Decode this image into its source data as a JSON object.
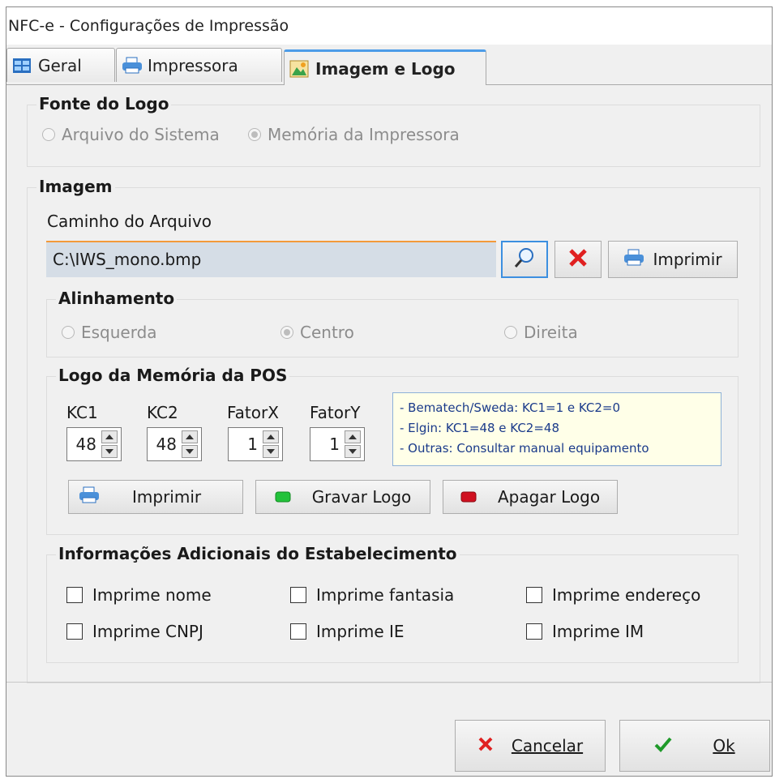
{
  "window": {
    "title": "NFC-e - Configurações de Impressão"
  },
  "tabs": [
    {
      "label": "Geral",
      "icon": "grid-icon"
    },
    {
      "label": "Impressora",
      "icon": "printer-icon"
    },
    {
      "label": "Imagem e Logo",
      "icon": "image-logo-icon",
      "active": true
    }
  ],
  "fonte_logo": {
    "title": "Fonte do Logo",
    "options": [
      {
        "label": "Arquivo do Sistema",
        "selected": false
      },
      {
        "label": "Memória da Impressora",
        "selected": true
      }
    ]
  },
  "imagem": {
    "title": "Imagem",
    "path_label": "Caminho do Arquivo",
    "path_value": "C:\\IWS_mono.bmp",
    "print_label": "Imprimir"
  },
  "alinhamento": {
    "title": "Alinhamento",
    "options": [
      {
        "label": "Esquerda",
        "selected": false
      },
      {
        "label": "Centro",
        "selected": true
      },
      {
        "label": "Direita",
        "selected": false
      }
    ]
  },
  "logo_pos": {
    "title": "Logo da Memória da POS",
    "fields": [
      {
        "label": "KC1",
        "value": "48"
      },
      {
        "label": "KC2",
        "value": "48"
      },
      {
        "label": "FatorX",
        "value": "1"
      },
      {
        "label": "FatorY",
        "value": "1"
      }
    ],
    "hint": [
      "- Bematech/Sweda: KC1=1 e KC2=0",
      "- Elgin: KC1=48 e KC2=48",
      "- Outras: Consultar manual equipamento"
    ],
    "buttons": {
      "print": "Imprimir",
      "save": "Gravar Logo",
      "delete": "Apagar Logo"
    }
  },
  "info_adicionais": {
    "title": "Informações Adicionais do Estabelecimento",
    "checks": [
      {
        "label": "Imprime nome",
        "checked": false
      },
      {
        "label": "Imprime fantasia",
        "checked": false
      },
      {
        "label": "Imprime endereço",
        "checked": false
      },
      {
        "label": "Imprime CNPJ",
        "checked": false
      },
      {
        "label": "Imprime IE",
        "checked": false
      },
      {
        "label": "Imprime IM",
        "checked": false
      }
    ]
  },
  "footer": {
    "cancel_label": "Cancelar",
    "ok_label": "Ok"
  },
  "colors": {
    "accent_blue": "#4c9ce8",
    "input_border_orange": "#f39a3a",
    "cancel_red": "#e02020",
    "ok_green": "#1f9a2a",
    "led_green": "#22c23a",
    "led_red": "#d01020"
  }
}
